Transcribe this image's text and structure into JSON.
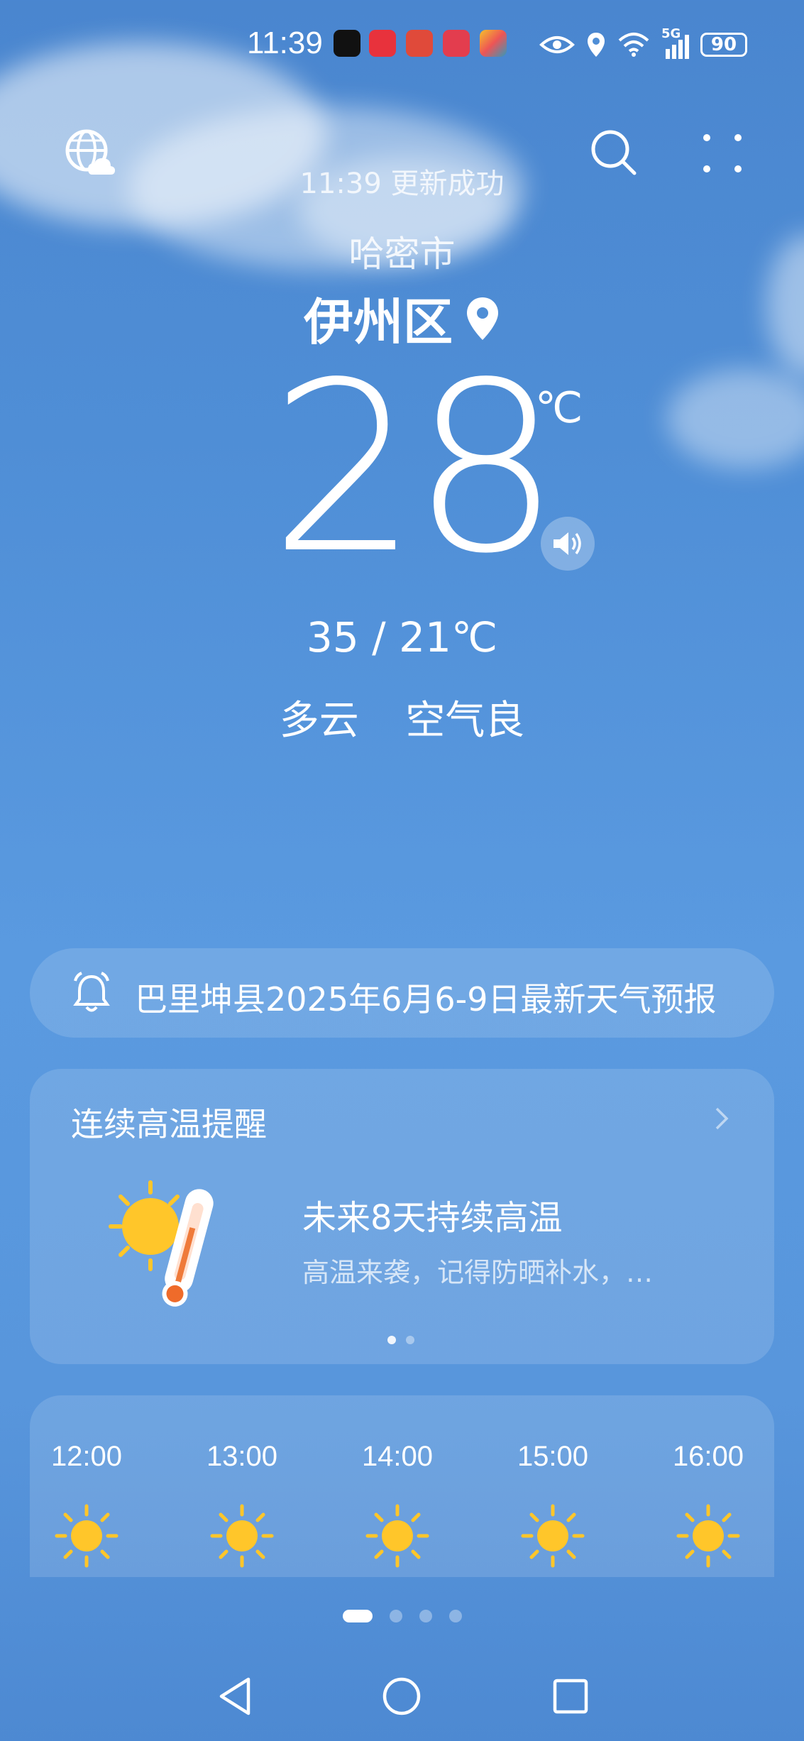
{
  "status_bar": {
    "time": "11:39",
    "signal_label": "5G",
    "battery": "90",
    "app_icons": [
      "douyin-icon",
      "618-app-icon",
      "shopping-app-icon",
      "reader-app-icon",
      "tools-app-icon"
    ],
    "indicator_icons": [
      "eye-icon",
      "location-icon",
      "wifi-icon",
      "cell-signal-icon",
      "battery-icon"
    ]
  },
  "header": {
    "update_status": "11:39 更新成功",
    "city": "哈密市",
    "district": "伊州区"
  },
  "current": {
    "temperature": "28",
    "unit": "℃",
    "high_low": "35 / 21℃",
    "condition": "多云",
    "air_quality": "空气良"
  },
  "alert_banner": {
    "text": "巴里坤县2025年6月6-9日最新天气预报"
  },
  "heat_card": {
    "title": "连续高温提醒",
    "headline": "未来8天持续高温",
    "subtext": "高温来袭，记得防晒补水，…"
  },
  "hourly": [
    {
      "time": "12:00",
      "icon": "sun-icon"
    },
    {
      "time": "13:00",
      "icon": "sun-icon"
    },
    {
      "time": "14:00",
      "icon": "sun-icon"
    },
    {
      "time": "15:00",
      "icon": "sun-icon"
    },
    {
      "time": "16:00",
      "icon": "sun-icon"
    }
  ],
  "colors": {
    "sky": "#4f8ed6",
    "sun": "#ffc62a"
  }
}
